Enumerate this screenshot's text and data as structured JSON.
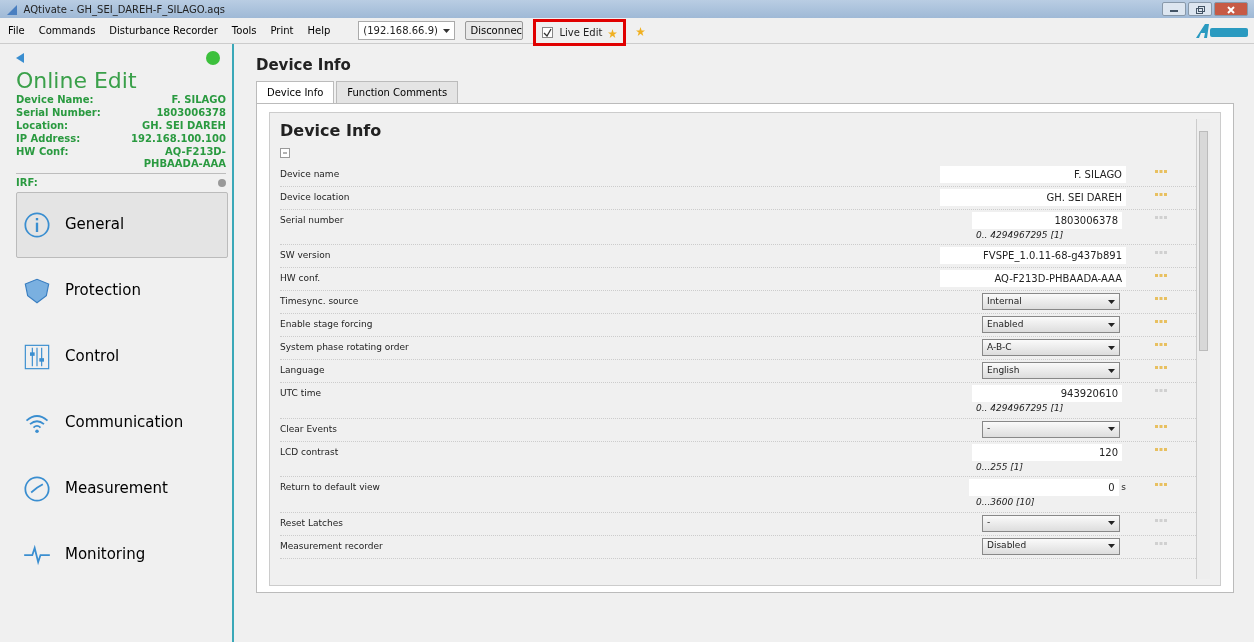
{
  "window": {
    "title": "AQtivate - GH_SEI_DAREH-F_SILAGO.aqs"
  },
  "menu": [
    "File",
    "Commands",
    "Disturbance Recorder",
    "Tools",
    "Print",
    "Help"
  ],
  "toolbar": {
    "connection": "(192.168.66.9)",
    "disconnect": "Disconnec",
    "live_edit": {
      "label": "Live Edit",
      "checked": true
    }
  },
  "sidebar": {
    "title": "Online Edit",
    "connected": true,
    "info": [
      {
        "label": "Device Name:",
        "value": "F. SILAGO"
      },
      {
        "label": "Serial Number:",
        "value": "1803006378"
      },
      {
        "label": "Location:",
        "value": "GH. SEI DAREH"
      },
      {
        "label": "IP Address:",
        "value": "192.168.100.100"
      },
      {
        "label": "HW Conf:",
        "value": "AQ-F213D-PHBAADA-AAA"
      }
    ],
    "irf": {
      "label": "IRF:",
      "active": false
    },
    "items": [
      {
        "label": "General",
        "kind": "info",
        "selected": true
      },
      {
        "label": "Protection",
        "kind": "shield",
        "selected": false
      },
      {
        "label": "Control",
        "kind": "sliders",
        "selected": false
      },
      {
        "label": "Communication",
        "kind": "wifi",
        "selected": false
      },
      {
        "label": "Measurement",
        "kind": "gauge",
        "selected": false
      },
      {
        "label": "Monitoring",
        "kind": "pulse",
        "selected": false
      }
    ]
  },
  "page_title": "Device Info",
  "tabs": [
    {
      "label": "Device Info",
      "selected": true
    },
    {
      "label": "Function Comments",
      "selected": false
    }
  ],
  "panel": {
    "title": "Device Info",
    "rows": [
      {
        "label": "Device name",
        "kind": "text",
        "value": "F. SILAGO",
        "wide": true,
        "color": "#e8c060"
      },
      {
        "label": "Device location",
        "kind": "text",
        "value": "GH. SEI DAREH",
        "wide": true,
        "color": "#e8c060"
      },
      {
        "label": "Serial number",
        "kind": "text",
        "value": "1803006378",
        "range": "0.. 4294967295 [1]",
        "wide": false,
        "color": "#d0d0d0"
      },
      {
        "label": "SW version",
        "kind": "text",
        "value": "FVSPE_1.0.11-68-g437b891",
        "wide": true,
        "color": "#d0d0d0"
      },
      {
        "label": "HW conf.",
        "kind": "text",
        "value": "AQ-F213D-PHBAADA-AAA",
        "wide": true,
        "color": "#e8c060"
      },
      {
        "label": "Timesync. source",
        "kind": "select",
        "value": "Internal",
        "color": "#e8c060"
      },
      {
        "label": "Enable stage forcing",
        "kind": "select",
        "value": "Enabled",
        "color": "#e8c060"
      },
      {
        "label": "System phase rotating order",
        "kind": "select",
        "value": "A-B-C",
        "color": "#e8c060"
      },
      {
        "label": "Language",
        "kind": "select",
        "value": "English",
        "color": "#e8c060"
      },
      {
        "label": "UTC time",
        "kind": "text",
        "value": "943920610",
        "range": "0.. 4294967295 [1]",
        "wide": false,
        "color": "#d0d0d0"
      },
      {
        "label": "Clear Events",
        "kind": "select",
        "value": "-",
        "color": "#e8c060"
      },
      {
        "label": "LCD contrast",
        "kind": "text",
        "value": "120",
        "range": "0...255 [1]",
        "wide": false,
        "color": "#e8c060"
      },
      {
        "label": "Return to default view",
        "kind": "text",
        "value": "0",
        "unit": "s",
        "range": "0...3600 [10]",
        "wide": false,
        "color": "#e8c060"
      },
      {
        "label": "Reset Latches",
        "kind": "select",
        "value": "-",
        "color": "#d0d0d0"
      },
      {
        "label": "Measurement recorder",
        "kind": "select",
        "value": "Disabled",
        "color": "#d0d0d0"
      }
    ]
  }
}
